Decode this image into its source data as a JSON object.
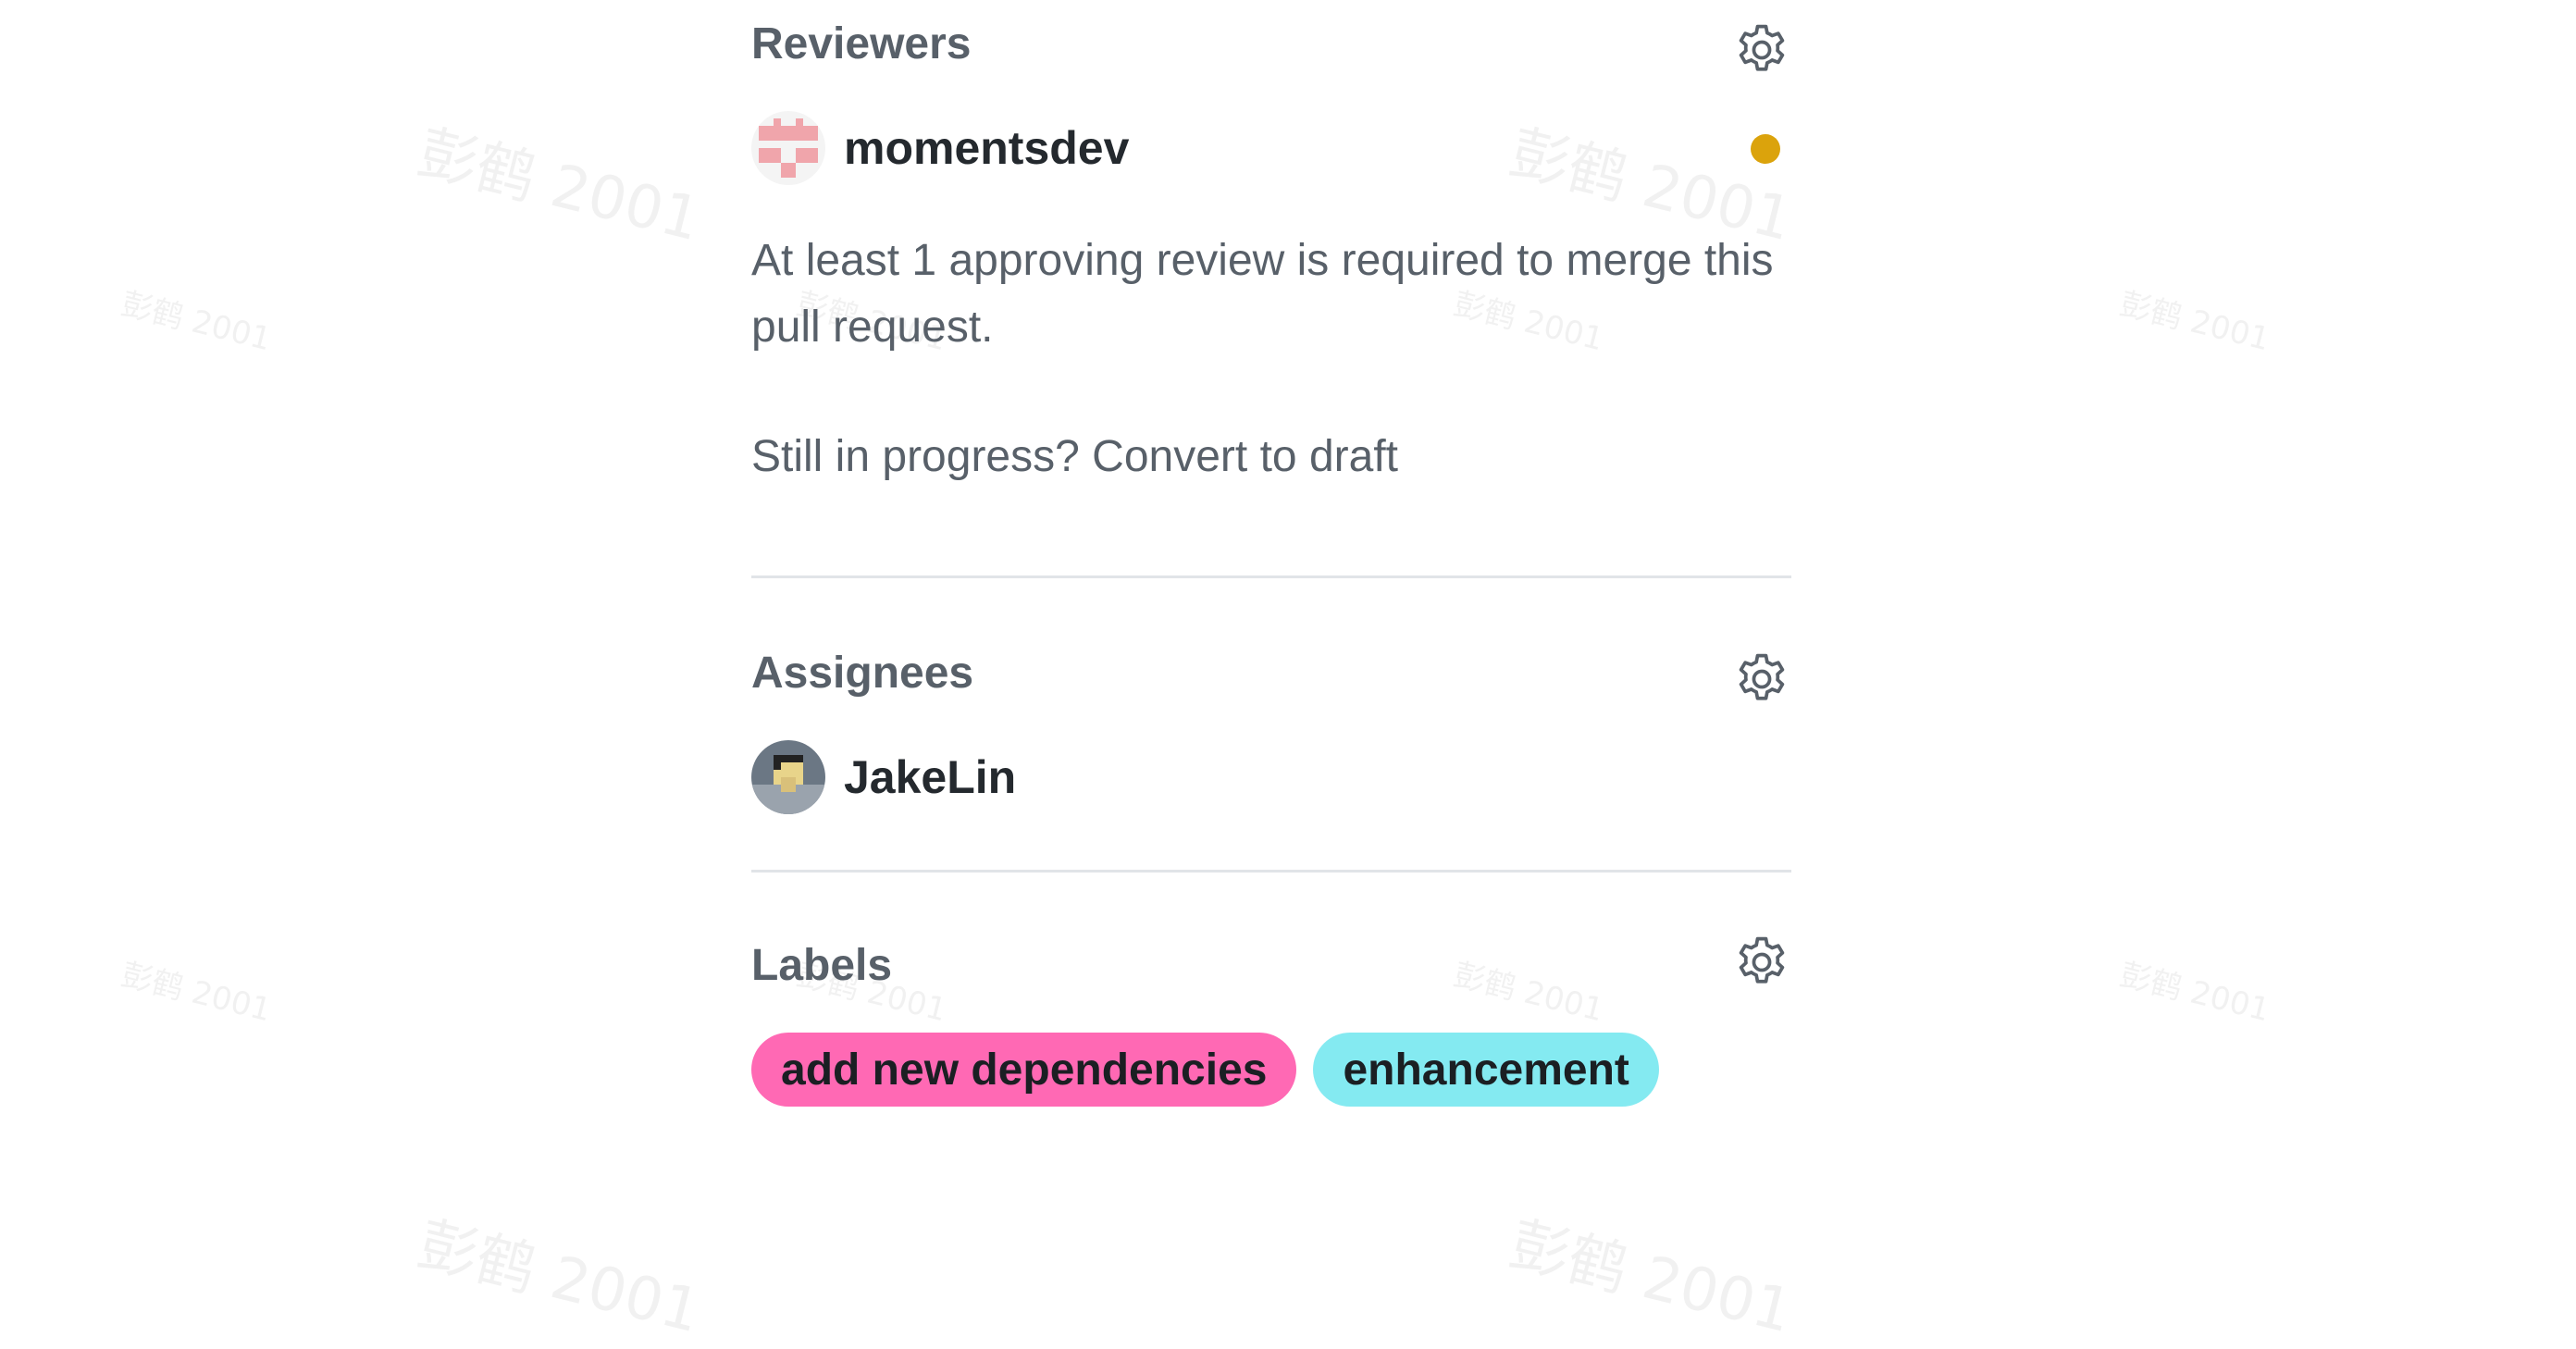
{
  "reviewers": {
    "title": "Reviewers",
    "gear_icon": "gear-icon",
    "user": {
      "name": "momentsdev",
      "avatar_icon": "identicon-avatar",
      "status_color": "#dba30c"
    },
    "note": "At least 1 approving review is required to merge this pull request.",
    "draft_prefix": "Still in progress?",
    "draft_link": "Convert to draft"
  },
  "assignees": {
    "title": "Assignees",
    "gear_icon": "gear-icon",
    "user": {
      "name": "JakeLin",
      "avatar_icon": "user-avatar"
    }
  },
  "labels": {
    "title": "Labels",
    "gear_icon": "gear-icon",
    "items": [
      {
        "name": "add new dependencies",
        "color": "#ff69b4"
      },
      {
        "name": "enhancement",
        "color": "#84eaf1"
      }
    ]
  },
  "watermark_text": "彭鹤 2001"
}
